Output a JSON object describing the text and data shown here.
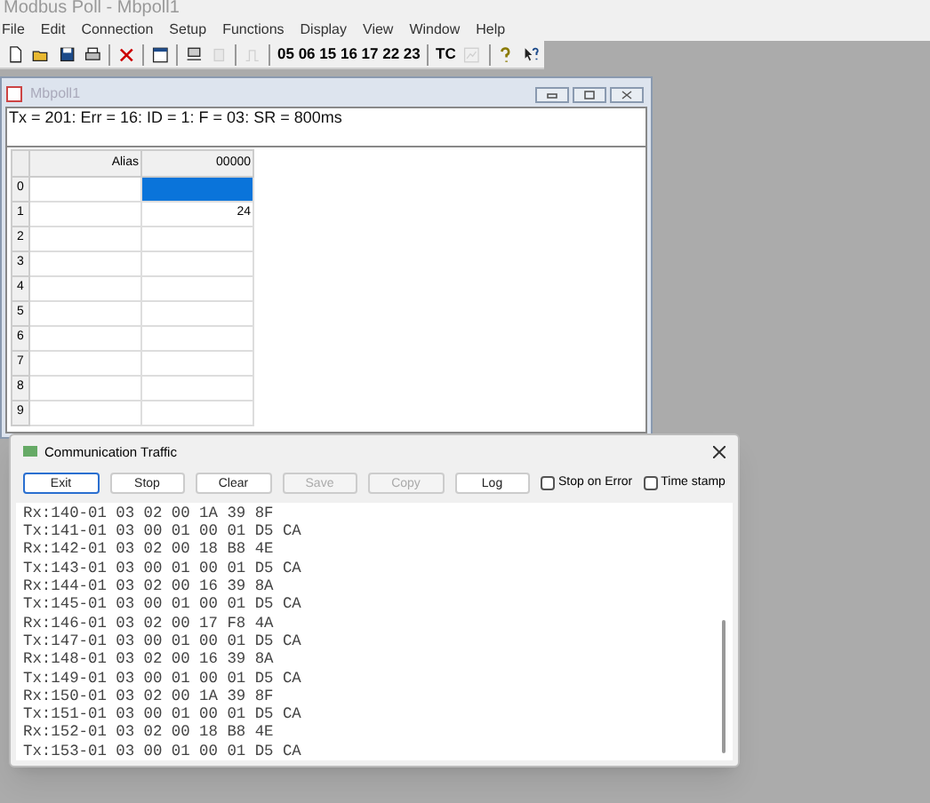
{
  "app_window": {
    "title": "Modbus Poll - Mbpoll1"
  },
  "menu": [
    "File",
    "Edit",
    "Connection",
    "Setup",
    "Functions",
    "Display",
    "View",
    "Window",
    "Help"
  ],
  "toolbar": [
    {
      "kind": "icon",
      "disabled": false
    },
    {
      "kind": "icon",
      "disabled": false
    },
    {
      "kind": "icon",
      "disabled": false
    },
    {
      "kind": "icon",
      "disabled": false
    },
    {
      "kind": "separator"
    },
    {
      "kind": "icon",
      "disabled": false
    },
    {
      "kind": "separator"
    },
    {
      "kind": "icon",
      "disabled": false
    },
    {
      "kind": "separator"
    },
    {
      "kind": "icon",
      "disabled": false
    },
    {
      "kind": "icon",
      "disabled": true
    },
    {
      "kind": "separator"
    },
    {
      "kind": "icon",
      "disabled": true
    },
    {
      "kind": "separator"
    },
    {
      "kind": "text",
      "label": "05 06 15 16 17 22 23"
    },
    {
      "kind": "separator"
    },
    {
      "kind": "text",
      "label": "TC"
    },
    {
      "kind": "icon",
      "disabled": true
    },
    {
      "kind": "separator"
    },
    {
      "kind": "icon",
      "disabled": false
    },
    {
      "kind": "icon",
      "disabled": false
    }
  ],
  "child_window": {
    "title": "Mbpoll1",
    "status": "Tx = 201: Err = 16: ID = 1: F = 03: SR = 800ms",
    "columns": [
      "Alias",
      "00000"
    ],
    "rows": [
      {
        "index": "0",
        "alias": "",
        "value": "",
        "selected": true
      },
      {
        "index": "1",
        "alias": "",
        "value": "24",
        "selected": false
      },
      {
        "index": "2",
        "alias": "",
        "value": "",
        "selected": false
      },
      {
        "index": "3",
        "alias": "",
        "value": "",
        "selected": false
      },
      {
        "index": "4",
        "alias": "",
        "value": "",
        "selected": false
      },
      {
        "index": "5",
        "alias": "",
        "value": "",
        "selected": false
      },
      {
        "index": "6",
        "alias": "",
        "value": "",
        "selected": false
      },
      {
        "index": "7",
        "alias": "",
        "value": "",
        "selected": false
      },
      {
        "index": "8",
        "alias": "",
        "value": "",
        "selected": false
      },
      {
        "index": "9",
        "alias": "",
        "value": "",
        "selected": false
      }
    ]
  },
  "traffic_dialog": {
    "title": "Communication Traffic",
    "buttons": [
      {
        "label": "Exit",
        "disabled": false,
        "default": true
      },
      {
        "label": "Stop",
        "disabled": false,
        "default": false
      },
      {
        "label": "Clear",
        "disabled": false,
        "default": false
      },
      {
        "label": "Save",
        "disabled": true,
        "default": false
      },
      {
        "label": "Copy",
        "disabled": true,
        "default": false
      },
      {
        "label": "Log",
        "disabled": false,
        "default": false
      }
    ],
    "checkboxes": [
      {
        "label": "Stop on Error",
        "checked": false
      },
      {
        "label": "Time stamp",
        "checked": false
      }
    ],
    "log": [
      "Rx:140-01 03 02 00 1A 39 8F",
      "Tx:141-01 03 00 01 00 01 D5 CA",
      "Rx:142-01 03 02 00 18 B8 4E",
      "Tx:143-01 03 00 01 00 01 D5 CA",
      "Rx:144-01 03 02 00 16 39 8A",
      "Tx:145-01 03 00 01 00 01 D5 CA",
      "Rx:146-01 03 02 00 17 F8 4A",
      "Tx:147-01 03 00 01 00 01 D5 CA",
      "Rx:148-01 03 02 00 16 39 8A",
      "Tx:149-01 03 00 01 00 01 D5 CA",
      "Rx:150-01 03 02 00 1A 39 8F",
      "Tx:151-01 03 00 01 00 01 D5 CA",
      "Rx:152-01 03 02 00 18 B8 4E",
      "Tx:153-01 03 00 01 00 01 D5 CA"
    ]
  }
}
